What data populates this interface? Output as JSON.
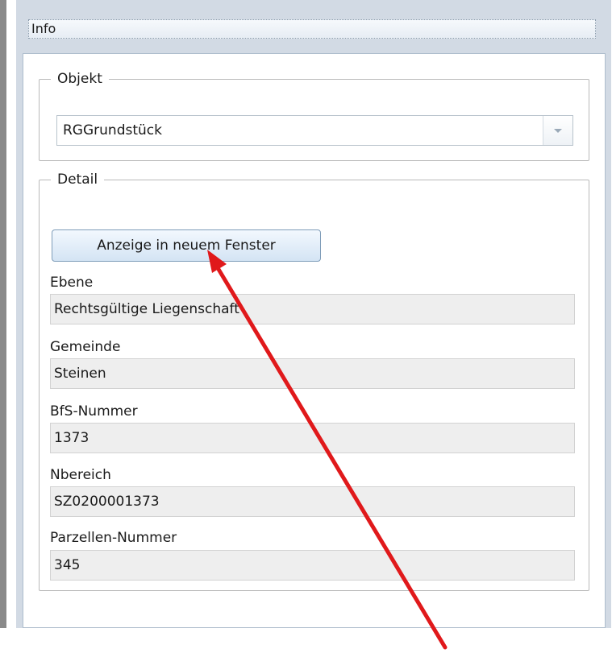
{
  "panel": {
    "title": "Info"
  },
  "objekt": {
    "legend": "Objekt",
    "selected": "RGGrundstück"
  },
  "detail": {
    "legend": "Detail",
    "button_label": "Anzeige in neuem Fenster",
    "fields": [
      {
        "label": "Ebene",
        "value": "Rechtsgültige Liegenschaft"
      },
      {
        "label": "Gemeinde",
        "value": "Steinen"
      },
      {
        "label": "BfS-Nummer",
        "value": "1373"
      },
      {
        "label": "Nbereich",
        "value": "SZ0200001373"
      },
      {
        "label": "Parzellen-Nummer",
        "value": "345"
      }
    ]
  },
  "icons": {
    "combo_trigger": "chevron-down-icon",
    "annotation": "red-arrow-annotation-icon"
  },
  "colors": {
    "annotation_arrow": "#e0191b",
    "button_top": "#f2f8fe",
    "button_bottom": "#d4e4f4",
    "readonly_field": "#eeeeee"
  }
}
